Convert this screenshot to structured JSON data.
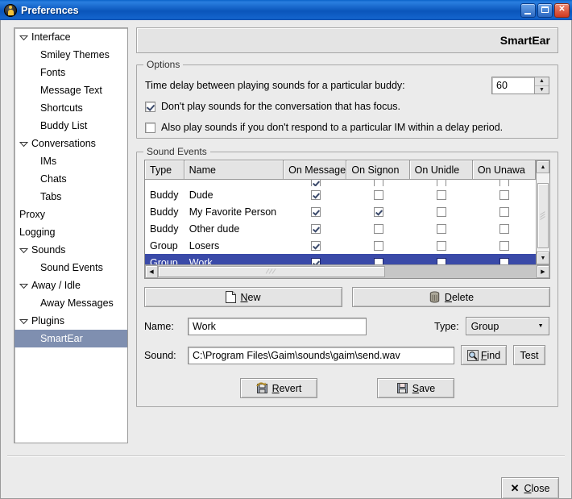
{
  "window": {
    "title": "Preferences",
    "icon": "person-icon",
    "controls": {
      "minimize": "minimize-icon",
      "maximize": "maximize-icon",
      "close": "close-icon"
    },
    "titlebar_color": "#0a55bb"
  },
  "sidebar": {
    "items": [
      {
        "label": "Interface",
        "level": 0,
        "expander": true,
        "selected": false
      },
      {
        "label": "Smiley Themes",
        "level": 1,
        "expander": false,
        "selected": false
      },
      {
        "label": "Fonts",
        "level": 1,
        "expander": false,
        "selected": false
      },
      {
        "label": "Message Text",
        "level": 1,
        "expander": false,
        "selected": false
      },
      {
        "label": "Shortcuts",
        "level": 1,
        "expander": false,
        "selected": false
      },
      {
        "label": "Buddy List",
        "level": 1,
        "expander": false,
        "selected": false
      },
      {
        "label": "Conversations",
        "level": 0,
        "expander": true,
        "selected": false
      },
      {
        "label": "IMs",
        "level": 1,
        "expander": false,
        "selected": false
      },
      {
        "label": "Chats",
        "level": 1,
        "expander": false,
        "selected": false
      },
      {
        "label": "Tabs",
        "level": 1,
        "expander": false,
        "selected": false
      },
      {
        "label": "Proxy",
        "level": 0,
        "expander": false,
        "selected": false
      },
      {
        "label": "Logging",
        "level": 0,
        "expander": false,
        "selected": false
      },
      {
        "label": "Sounds",
        "level": 0,
        "expander": true,
        "selected": false
      },
      {
        "label": "Sound Events",
        "level": 1,
        "expander": false,
        "selected": false
      },
      {
        "label": "Away / Idle",
        "level": 0,
        "expander": true,
        "selected": false
      },
      {
        "label": "Away Messages",
        "level": 1,
        "expander": false,
        "selected": false
      },
      {
        "label": "Plugins",
        "level": 0,
        "expander": true,
        "selected": false
      },
      {
        "label": "SmartEar",
        "level": 1,
        "expander": false,
        "selected": true
      }
    ],
    "selection_color": "#7f8fb0"
  },
  "page": {
    "title": "SmartEar"
  },
  "options": {
    "frame_title": "Options",
    "delay_label": "Time delay between playing sounds for a particular buddy:",
    "delay_value": "60",
    "checkboxes": [
      {
        "label": "Don't play sounds for the conversation that has focus.",
        "checked": true
      },
      {
        "label": "Also play sounds if you don't respond to a particular IM within a delay period.",
        "checked": false
      }
    ]
  },
  "sound_events": {
    "frame_title": "Sound Events",
    "columns": [
      "Type",
      "Name",
      "On Message",
      "On Signon",
      "On Unidle",
      "On Unawa"
    ],
    "rows": [
      {
        "type": "Buddy",
        "name": "Dude",
        "on_message": true,
        "on_signon": false,
        "on_unidle": false,
        "on_unaway": false,
        "selected": false
      },
      {
        "type": "Buddy",
        "name": "My Favorite Person",
        "on_message": true,
        "on_signon": true,
        "on_unidle": false,
        "on_unaway": false,
        "selected": false
      },
      {
        "type": "Buddy",
        "name": "Other dude",
        "on_message": true,
        "on_signon": false,
        "on_unidle": false,
        "on_unaway": false,
        "selected": false
      },
      {
        "type": "Group",
        "name": "Losers",
        "on_message": true,
        "on_signon": false,
        "on_unidle": false,
        "on_unaway": false,
        "selected": false
      },
      {
        "type": "Group",
        "name": "Work",
        "on_message": true,
        "on_signon": false,
        "on_unidle": false,
        "on_unaway": false,
        "selected": true
      }
    ],
    "selection_color": "#3a4aa8",
    "scrollbars": {
      "vertical_up": "scroll-up-icon",
      "vertical_down": "scroll-down-icon",
      "horizontal_left": "scroll-left-icon",
      "horizontal_right": "scroll-right-icon"
    }
  },
  "editor": {
    "new_button": {
      "label": "New",
      "mnemonic": "N",
      "icon": "new-document-icon"
    },
    "delete_button": {
      "label": "Delete",
      "mnemonic": "D",
      "icon": "trash-can-icon"
    },
    "name_label": "Name:",
    "name_value": "Work",
    "type_label": "Type:",
    "type_value": "Group",
    "sound_label": "Sound:",
    "sound_value": "C:\\Program Files\\Gaim\\sounds\\gaim\\send.wav",
    "find_button": {
      "label": "Find",
      "mnemonic": "F",
      "icon": "magnifier-icon"
    },
    "test_button": {
      "label": "Test"
    }
  },
  "actions": {
    "revert_button": {
      "label": "Revert",
      "mnemonic": "R",
      "icon": "revert-disk-icon"
    },
    "save_button": {
      "label": "Save",
      "mnemonic": "S",
      "icon": "floppy-disk-icon"
    },
    "close_button": {
      "label": "Close",
      "mnemonic": "C",
      "icon": "x-icon"
    }
  }
}
